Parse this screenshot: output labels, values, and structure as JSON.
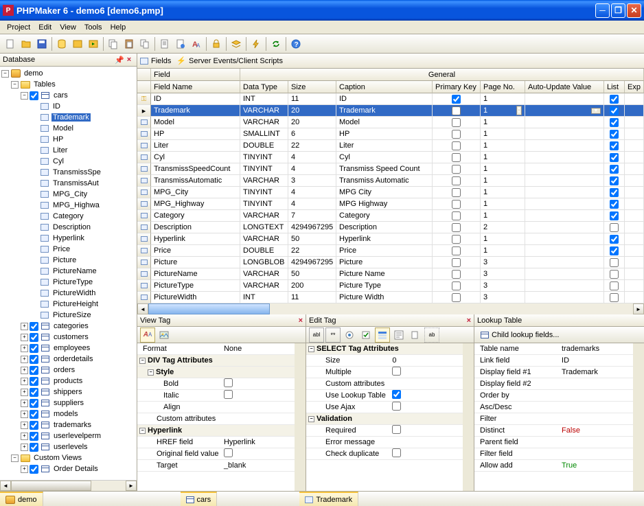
{
  "window": {
    "title": "PHPMaker 6 - demo6 [demo6.pmp]",
    "app_icon_letter": "P"
  },
  "menubar": [
    "Project",
    "Edit",
    "View",
    "Tools",
    "Help"
  ],
  "leftpanel": {
    "title": "Database"
  },
  "tree": {
    "root": "demo",
    "tables_label": "Tables",
    "cars_label": "cars",
    "cars_fields": [
      "ID",
      "Trademark",
      "Model",
      "HP",
      "Liter",
      "Cyl",
      "TransmissSpe",
      "TransmissAut",
      "MPG_City",
      "MPG_Highwa",
      "Category",
      "Description",
      "Hyperlink",
      "Price",
      "Picture",
      "PictureName",
      "PictureType",
      "PictureWidth",
      "PictureHeight",
      "PictureSize"
    ],
    "selected_field": "Trademark",
    "other_tables": [
      "categories",
      "customers",
      "employees",
      "orderdetails",
      "orders",
      "products",
      "shippers",
      "suppliers",
      "models",
      "trademarks",
      "userlevelperm",
      "userlevels"
    ],
    "custom_views_label": "Custom Views",
    "custom_views": [
      "Order Details"
    ]
  },
  "tabbar": {
    "fields": "Fields",
    "server_events": "Server Events/Client Scripts"
  },
  "grid": {
    "top_headers": {
      "field": "Field",
      "general": "General"
    },
    "columns": [
      "Field Name",
      "Data Type",
      "Size",
      "Caption",
      "Primary Key",
      "Page No.",
      "Auto-Update Value",
      "List",
      "Exp"
    ],
    "selected_index": 1,
    "rows": [
      {
        "name": "ID",
        "dtype": "INT",
        "size": "11",
        "caption": "ID",
        "pk": true,
        "page": "1",
        "auto": "",
        "list": true,
        "key": true
      },
      {
        "name": "Trademark",
        "dtype": "VARCHAR",
        "size": "20",
        "caption": "Trademark",
        "pk": false,
        "page": "1",
        "auto": "",
        "list": true
      },
      {
        "name": "Model",
        "dtype": "VARCHAR",
        "size": "20",
        "caption": "Model",
        "pk": false,
        "page": "1",
        "auto": "",
        "list": true
      },
      {
        "name": "HP",
        "dtype": "SMALLINT",
        "size": "6",
        "caption": "HP",
        "pk": false,
        "page": "1",
        "auto": "",
        "list": true
      },
      {
        "name": "Liter",
        "dtype": "DOUBLE",
        "size": "22",
        "caption": "Liter",
        "pk": false,
        "page": "1",
        "auto": "",
        "list": true
      },
      {
        "name": "Cyl",
        "dtype": "TINYINT",
        "size": "4",
        "caption": "Cyl",
        "pk": false,
        "page": "1",
        "auto": "",
        "list": true
      },
      {
        "name": "TransmissSpeedCount",
        "dtype": "TINYINT",
        "size": "4",
        "caption": "Transmiss Speed Count",
        "pk": false,
        "page": "1",
        "auto": "",
        "list": true
      },
      {
        "name": "TransmissAutomatic",
        "dtype": "VARCHAR",
        "size": "3",
        "caption": "Transmiss Automatic",
        "pk": false,
        "page": "1",
        "auto": "",
        "list": true
      },
      {
        "name": "MPG_City",
        "dtype": "TINYINT",
        "size": "4",
        "caption": "MPG City",
        "pk": false,
        "page": "1",
        "auto": "",
        "list": true
      },
      {
        "name": "MPG_Highway",
        "dtype": "TINYINT",
        "size": "4",
        "caption": "MPG Highway",
        "pk": false,
        "page": "1",
        "auto": "",
        "list": true
      },
      {
        "name": "Category",
        "dtype": "VARCHAR",
        "size": "7",
        "caption": "Category",
        "pk": false,
        "page": "1",
        "auto": "",
        "list": true
      },
      {
        "name": "Description",
        "dtype": "LONGTEXT",
        "size": "4294967295",
        "caption": "Description",
        "pk": false,
        "page": "2",
        "auto": "",
        "list": false
      },
      {
        "name": "Hyperlink",
        "dtype": "VARCHAR",
        "size": "50",
        "caption": "Hyperlink",
        "pk": false,
        "page": "1",
        "auto": "",
        "list": true
      },
      {
        "name": "Price",
        "dtype": "DOUBLE",
        "size": "22",
        "caption": "Price",
        "pk": false,
        "page": "1",
        "auto": "",
        "list": true
      },
      {
        "name": "Picture",
        "dtype": "LONGBLOB",
        "size": "4294967295",
        "caption": "Picture",
        "pk": false,
        "page": "3",
        "auto": "",
        "list": false
      },
      {
        "name": "PictureName",
        "dtype": "VARCHAR",
        "size": "50",
        "caption": "Picture Name",
        "pk": false,
        "page": "3",
        "auto": "",
        "list": false
      },
      {
        "name": "PictureType",
        "dtype": "VARCHAR",
        "size": "200",
        "caption": "Picture Type",
        "pk": false,
        "page": "3",
        "auto": "",
        "list": false
      },
      {
        "name": "PictureWidth",
        "dtype": "INT",
        "size": "11",
        "caption": "Picture Width",
        "pk": false,
        "page": "3",
        "auto": "",
        "list": false
      }
    ]
  },
  "viewtag": {
    "title": "View Tag",
    "format_label": "Format",
    "format_value": "None",
    "div_attrs": "DIV Tag Attributes",
    "style": "Style",
    "bold": "Bold",
    "italic": "Italic",
    "align": "Align",
    "custom_attrs": "Custom attributes",
    "hyperlink": "Hyperlink",
    "href_field": "HREF field",
    "href_value": "Hyperlink",
    "original": "Original field value",
    "target": "Target",
    "target_value": "_blank"
  },
  "edittag": {
    "title": "Edit Tag",
    "select_attrs": "SELECT Tag Attributes",
    "size": "Size",
    "size_val": "0",
    "multiple": "Multiple",
    "custom_attrs": "Custom attributes",
    "use_lookup": "Use Lookup Table",
    "use_ajax": "Use Ajax",
    "validation": "Validation",
    "required": "Required",
    "error_msg": "Error message",
    "check_dup": "Check duplicate"
  },
  "lookup": {
    "title": "Lookup Table",
    "child_lookup": "Child lookup fields...",
    "table_name_l": "Table name",
    "table_name_v": "trademarks",
    "link_field_l": "Link field",
    "link_field_v": "ID",
    "display1_l": "Display field #1",
    "display1_v": "Trademark",
    "display2_l": "Display field #2",
    "orderby_l": "Order by",
    "ascdesc_l": "Asc/Desc",
    "filter_l": "Filter",
    "distinct_l": "Distinct",
    "distinct_v": "False",
    "parent_l": "Parent field",
    "filterfield_l": "Filter field",
    "allowadd_l": "Allow add",
    "allowadd_v": "True"
  },
  "statusbar": {
    "tab1": "demo",
    "tab2": "cars",
    "tab3": "Trademark"
  }
}
